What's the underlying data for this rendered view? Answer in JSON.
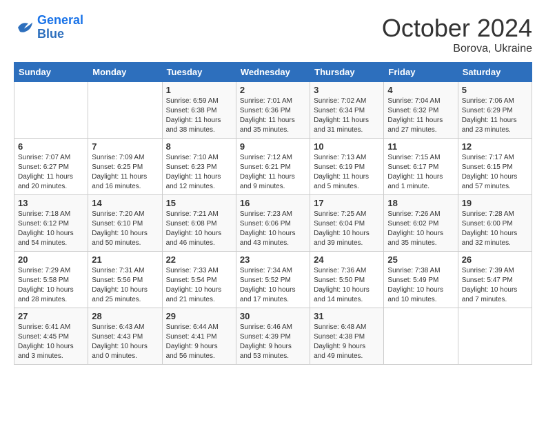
{
  "logo": {
    "line1": "General",
    "line2": "Blue"
  },
  "title": "October 2024",
  "subtitle": "Borova, Ukraine",
  "days_header": [
    "Sunday",
    "Monday",
    "Tuesday",
    "Wednesday",
    "Thursday",
    "Friday",
    "Saturday"
  ],
  "weeks": [
    [
      {
        "day": "",
        "detail": ""
      },
      {
        "day": "",
        "detail": ""
      },
      {
        "day": "1",
        "detail": "Sunrise: 6:59 AM\nSunset: 6:38 PM\nDaylight: 11 hours\nand 38 minutes."
      },
      {
        "day": "2",
        "detail": "Sunrise: 7:01 AM\nSunset: 6:36 PM\nDaylight: 11 hours\nand 35 minutes."
      },
      {
        "day": "3",
        "detail": "Sunrise: 7:02 AM\nSunset: 6:34 PM\nDaylight: 11 hours\nand 31 minutes."
      },
      {
        "day": "4",
        "detail": "Sunrise: 7:04 AM\nSunset: 6:32 PM\nDaylight: 11 hours\nand 27 minutes."
      },
      {
        "day": "5",
        "detail": "Sunrise: 7:06 AM\nSunset: 6:29 PM\nDaylight: 11 hours\nand 23 minutes."
      }
    ],
    [
      {
        "day": "6",
        "detail": "Sunrise: 7:07 AM\nSunset: 6:27 PM\nDaylight: 11 hours\nand 20 minutes."
      },
      {
        "day": "7",
        "detail": "Sunrise: 7:09 AM\nSunset: 6:25 PM\nDaylight: 11 hours\nand 16 minutes."
      },
      {
        "day": "8",
        "detail": "Sunrise: 7:10 AM\nSunset: 6:23 PM\nDaylight: 11 hours\nand 12 minutes."
      },
      {
        "day": "9",
        "detail": "Sunrise: 7:12 AM\nSunset: 6:21 PM\nDaylight: 11 hours\nand 9 minutes."
      },
      {
        "day": "10",
        "detail": "Sunrise: 7:13 AM\nSunset: 6:19 PM\nDaylight: 11 hours\nand 5 minutes."
      },
      {
        "day": "11",
        "detail": "Sunrise: 7:15 AM\nSunset: 6:17 PM\nDaylight: 11 hours\nand 1 minute."
      },
      {
        "day": "12",
        "detail": "Sunrise: 7:17 AM\nSunset: 6:15 PM\nDaylight: 10 hours\nand 57 minutes."
      }
    ],
    [
      {
        "day": "13",
        "detail": "Sunrise: 7:18 AM\nSunset: 6:12 PM\nDaylight: 10 hours\nand 54 minutes."
      },
      {
        "day": "14",
        "detail": "Sunrise: 7:20 AM\nSunset: 6:10 PM\nDaylight: 10 hours\nand 50 minutes."
      },
      {
        "day": "15",
        "detail": "Sunrise: 7:21 AM\nSunset: 6:08 PM\nDaylight: 10 hours\nand 46 minutes."
      },
      {
        "day": "16",
        "detail": "Sunrise: 7:23 AM\nSunset: 6:06 PM\nDaylight: 10 hours\nand 43 minutes."
      },
      {
        "day": "17",
        "detail": "Sunrise: 7:25 AM\nSunset: 6:04 PM\nDaylight: 10 hours\nand 39 minutes."
      },
      {
        "day": "18",
        "detail": "Sunrise: 7:26 AM\nSunset: 6:02 PM\nDaylight: 10 hours\nand 35 minutes."
      },
      {
        "day": "19",
        "detail": "Sunrise: 7:28 AM\nSunset: 6:00 PM\nDaylight: 10 hours\nand 32 minutes."
      }
    ],
    [
      {
        "day": "20",
        "detail": "Sunrise: 7:29 AM\nSunset: 5:58 PM\nDaylight: 10 hours\nand 28 minutes."
      },
      {
        "day": "21",
        "detail": "Sunrise: 7:31 AM\nSunset: 5:56 PM\nDaylight: 10 hours\nand 25 minutes."
      },
      {
        "day": "22",
        "detail": "Sunrise: 7:33 AM\nSunset: 5:54 PM\nDaylight: 10 hours\nand 21 minutes."
      },
      {
        "day": "23",
        "detail": "Sunrise: 7:34 AM\nSunset: 5:52 PM\nDaylight: 10 hours\nand 17 minutes."
      },
      {
        "day": "24",
        "detail": "Sunrise: 7:36 AM\nSunset: 5:50 PM\nDaylight: 10 hours\nand 14 minutes."
      },
      {
        "day": "25",
        "detail": "Sunrise: 7:38 AM\nSunset: 5:49 PM\nDaylight: 10 hours\nand 10 minutes."
      },
      {
        "day": "26",
        "detail": "Sunrise: 7:39 AM\nSunset: 5:47 PM\nDaylight: 10 hours\nand 7 minutes."
      }
    ],
    [
      {
        "day": "27",
        "detail": "Sunrise: 6:41 AM\nSunset: 4:45 PM\nDaylight: 10 hours\nand 3 minutes."
      },
      {
        "day": "28",
        "detail": "Sunrise: 6:43 AM\nSunset: 4:43 PM\nDaylight: 10 hours\nand 0 minutes."
      },
      {
        "day": "29",
        "detail": "Sunrise: 6:44 AM\nSunset: 4:41 PM\nDaylight: 9 hours\nand 56 minutes."
      },
      {
        "day": "30",
        "detail": "Sunrise: 6:46 AM\nSunset: 4:39 PM\nDaylight: 9 hours\nand 53 minutes."
      },
      {
        "day": "31",
        "detail": "Sunrise: 6:48 AM\nSunset: 4:38 PM\nDaylight: 9 hours\nand 49 minutes."
      },
      {
        "day": "",
        "detail": ""
      },
      {
        "day": "",
        "detail": ""
      }
    ]
  ]
}
